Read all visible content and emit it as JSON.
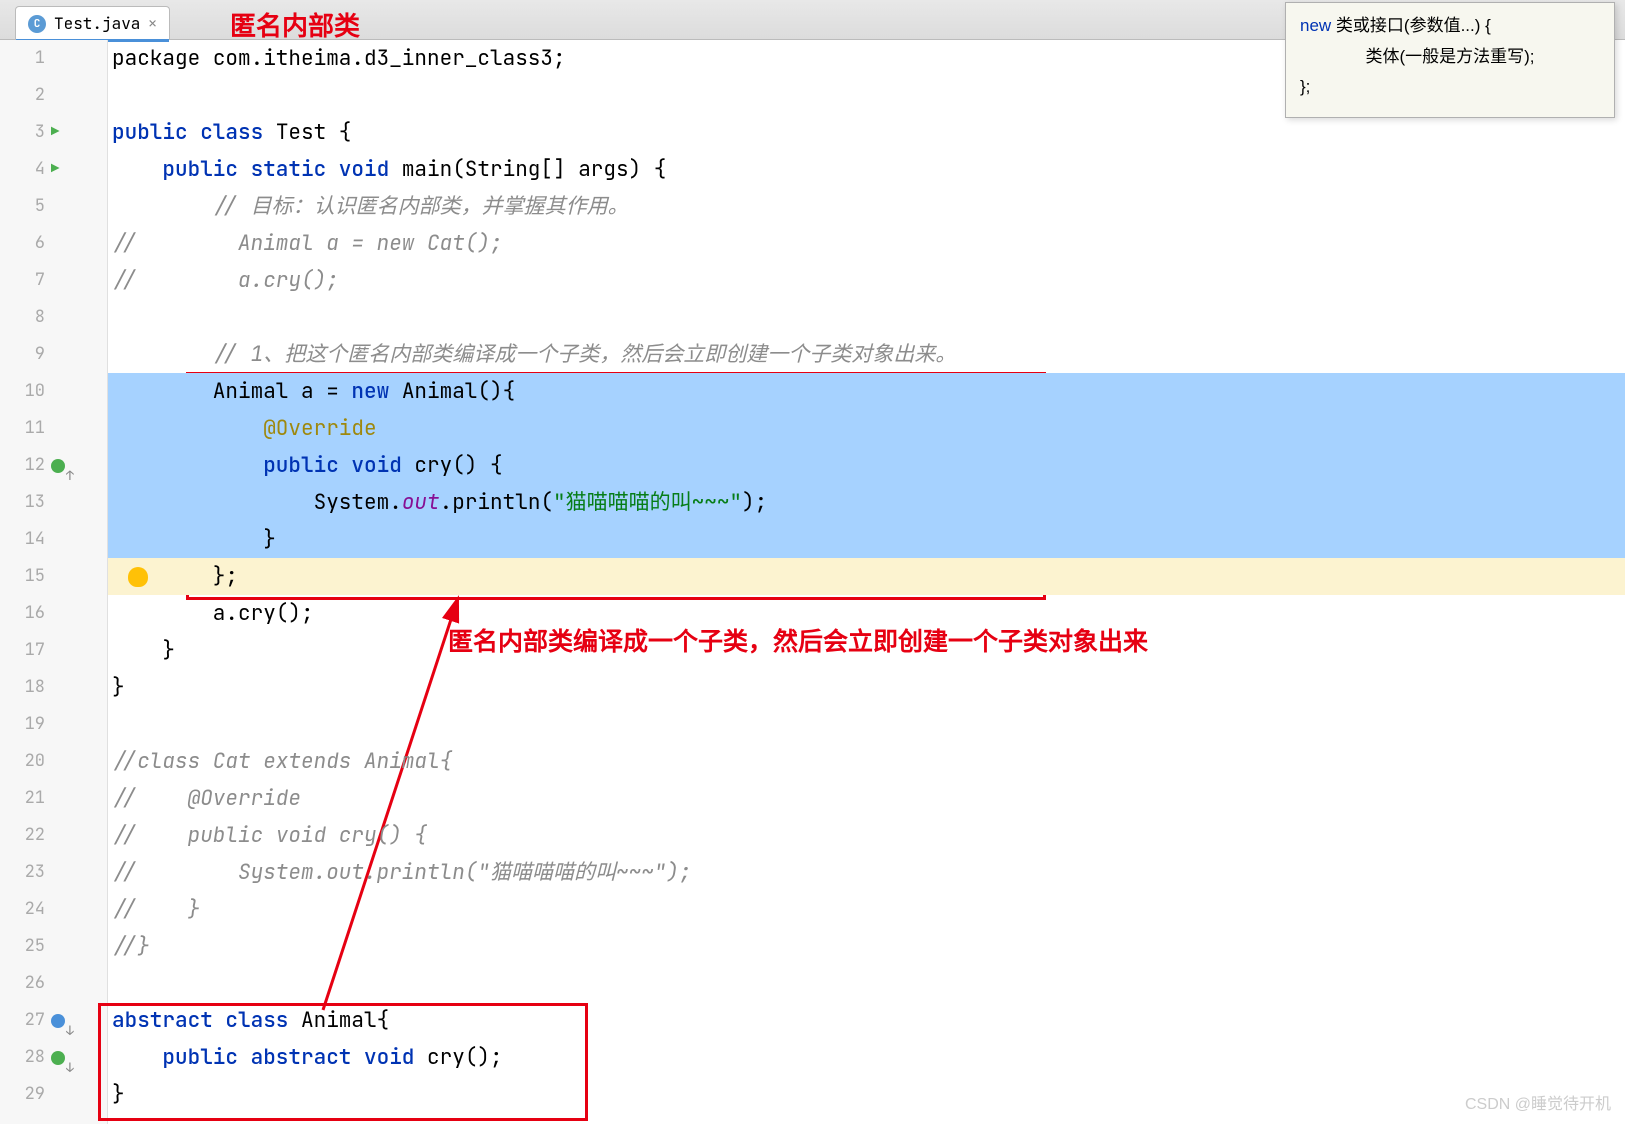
{
  "tab": {
    "filename": "Test.java",
    "icon_letter": "C"
  },
  "title_annotation": "匿名内部类",
  "tooltip": {
    "kw": "new",
    "line1_rest": " 类或接口(参数值...) {",
    "line2": "类体(一般是方法重写);",
    "line3": "};"
  },
  "annotations": {
    "explain": "匿名内部类编译成一个子类，然后会立即创建一个子类对象出来"
  },
  "watermark": "CSDN @睡觉待开机",
  "lines": [
    {
      "n": 1,
      "segs": [
        {
          "t": "plain",
          "v": "package "
        },
        {
          "t": "plain",
          "v": "com.itheima.d3_inner_class3;"
        }
      ]
    },
    {
      "n": 2,
      "segs": []
    },
    {
      "n": 3,
      "run": true,
      "segs": [
        {
          "t": "kw",
          "v": "public class "
        },
        {
          "t": "plain",
          "v": "Test {"
        }
      ]
    },
    {
      "n": 4,
      "run": true,
      "segs": [
        {
          "t": "plain",
          "v": "    "
        },
        {
          "t": "kw",
          "v": "public static void "
        },
        {
          "t": "plain",
          "v": "main(String[] args) {"
        }
      ]
    },
    {
      "n": 5,
      "segs": [
        {
          "t": "plain",
          "v": "        "
        },
        {
          "t": "com",
          "v": "// 目标：认识匿名内部类，并掌握其作用。"
        }
      ]
    },
    {
      "n": 6,
      "segs": [
        {
          "t": "com",
          "v": "//        Animal a = new Cat();"
        }
      ]
    },
    {
      "n": 7,
      "segs": [
        {
          "t": "com",
          "v": "//        a.cry();"
        }
      ]
    },
    {
      "n": 8,
      "segs": []
    },
    {
      "n": 9,
      "segs": [
        {
          "t": "plain",
          "v": "        "
        },
        {
          "t": "com",
          "v": "// 1、把这个匿名内部类编译成一个子类，然后会立即创建一个子类对象出来。"
        }
      ]
    },
    {
      "n": 10,
      "sel": true,
      "segs": [
        {
          "t": "plain",
          "v": "        Animal a = "
        },
        {
          "t": "kw",
          "v": "new "
        },
        {
          "t": "plain",
          "v": "Animal(){"
        }
      ]
    },
    {
      "n": 11,
      "sel": true,
      "segs": [
        {
          "t": "plain",
          "v": "            "
        },
        {
          "t": "ann",
          "v": "@Override"
        }
      ]
    },
    {
      "n": 12,
      "sel": true,
      "ov_up": true,
      "segs": [
        {
          "t": "plain",
          "v": "            "
        },
        {
          "t": "kw",
          "v": "public void "
        },
        {
          "t": "plain",
          "v": "cry() {"
        }
      ]
    },
    {
      "n": 13,
      "sel": true,
      "segs": [
        {
          "t": "plain",
          "v": "                System."
        },
        {
          "t": "field",
          "v": "out"
        },
        {
          "t": "plain",
          "v": ".println("
        },
        {
          "t": "str",
          "v": "\"猫喵喵喵的叫~~~\""
        },
        {
          "t": "plain",
          "v": ");"
        }
      ]
    },
    {
      "n": 14,
      "sel": true,
      "segs": [
        {
          "t": "plain",
          "v": "            }"
        }
      ]
    },
    {
      "n": 15,
      "cur": true,
      "bulb": true,
      "segs": [
        {
          "t": "plain",
          "v": "        };"
        }
      ]
    },
    {
      "n": 16,
      "segs": [
        {
          "t": "plain",
          "v": "        a.cry();"
        }
      ]
    },
    {
      "n": 17,
      "segs": [
        {
          "t": "plain",
          "v": "    }"
        }
      ]
    },
    {
      "n": 18,
      "segs": [
        {
          "t": "plain",
          "v": "}"
        }
      ]
    },
    {
      "n": 19,
      "segs": []
    },
    {
      "n": 20,
      "segs": [
        {
          "t": "com",
          "v": "//class Cat extends Animal{"
        }
      ]
    },
    {
      "n": 21,
      "segs": [
        {
          "t": "com",
          "v": "//    @Override"
        }
      ]
    },
    {
      "n": 22,
      "segs": [
        {
          "t": "com",
          "v": "//    public void cry() {"
        }
      ]
    },
    {
      "n": 23,
      "segs": [
        {
          "t": "com",
          "v": "//        System.out.println(\"猫喵喵喵的叫~~~\");"
        }
      ]
    },
    {
      "n": 24,
      "segs": [
        {
          "t": "com",
          "v": "//    }"
        }
      ]
    },
    {
      "n": 25,
      "segs": [
        {
          "t": "com",
          "v": "//}"
        }
      ]
    },
    {
      "n": 26,
      "segs": []
    },
    {
      "n": 27,
      "ov_down": true,
      "segs": [
        {
          "t": "kw",
          "v": "abstract class "
        },
        {
          "t": "plain",
          "v": "Animal{"
        }
      ]
    },
    {
      "n": 28,
      "impl_down": true,
      "segs": [
        {
          "t": "plain",
          "v": "    "
        },
        {
          "t": "kw",
          "v": "public abstract void "
        },
        {
          "t": "plain",
          "v": "cry();"
        }
      ]
    },
    {
      "n": 29,
      "segs": [
        {
          "t": "plain",
          "v": "}"
        }
      ]
    }
  ]
}
